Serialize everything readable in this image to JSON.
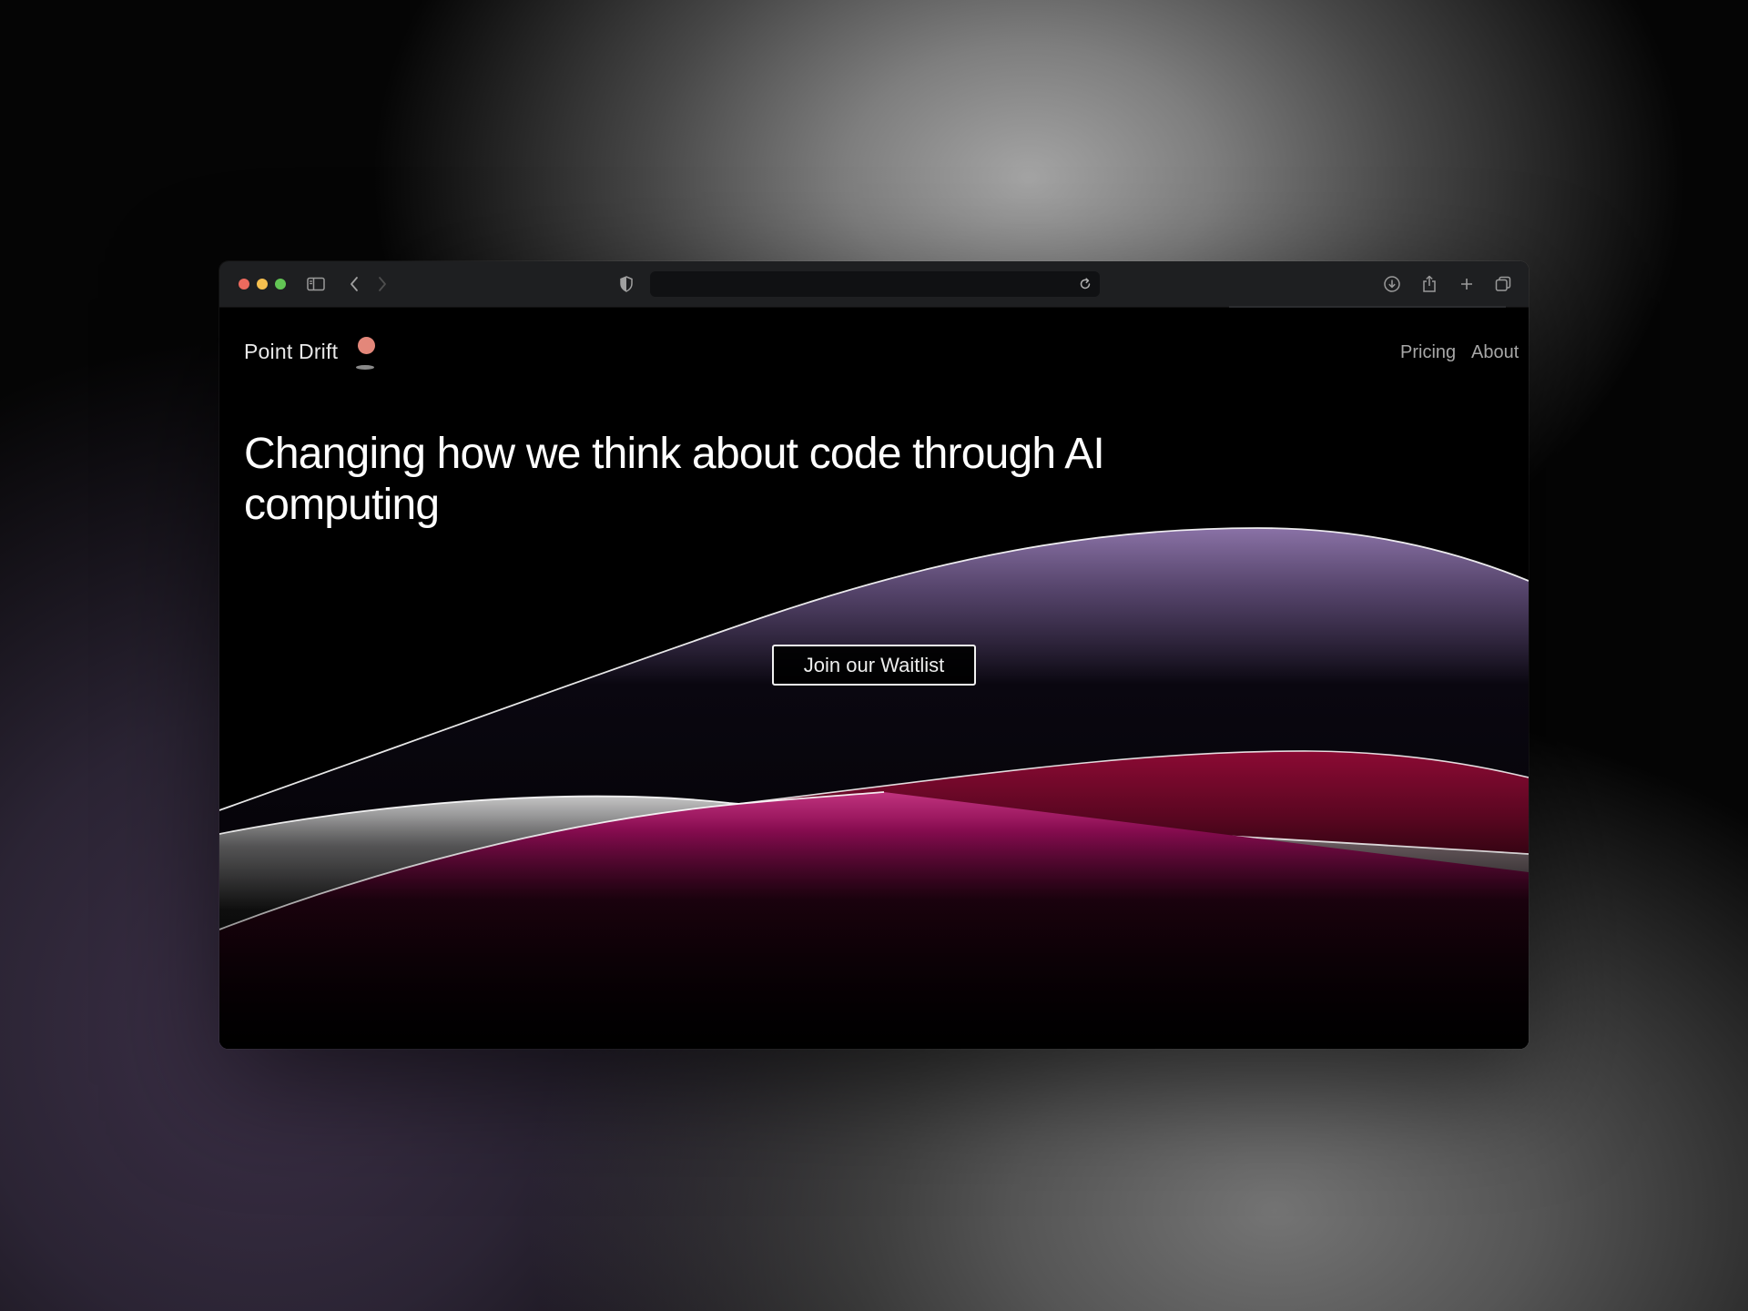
{
  "site": {
    "brand_name": "Point Drift",
    "nav": [
      {
        "label": "Pricing"
      },
      {
        "label": "About"
      }
    ],
    "headline": "Changing how we think about code through AI computing",
    "cta_label": "Join our Waitlist"
  },
  "browser": {
    "address_bar_value": "",
    "traffic_lights": {
      "close": "#ed6a5e",
      "minimize": "#f5bf4f",
      "zoom": "#62c554"
    },
    "icons": [
      "sidebar-icon",
      "back-icon",
      "forward-icon",
      "shield-icon",
      "reload-icon",
      "download-icon",
      "share-icon",
      "new-tab-icon",
      "tab-overview-icon"
    ]
  },
  "colors": {
    "brand_mark": "#e3877a",
    "wave_purple": "#76608f",
    "wave_magenta": "#c4146e",
    "wave_gray": "#bcbcbc",
    "page_background": "#000000"
  }
}
